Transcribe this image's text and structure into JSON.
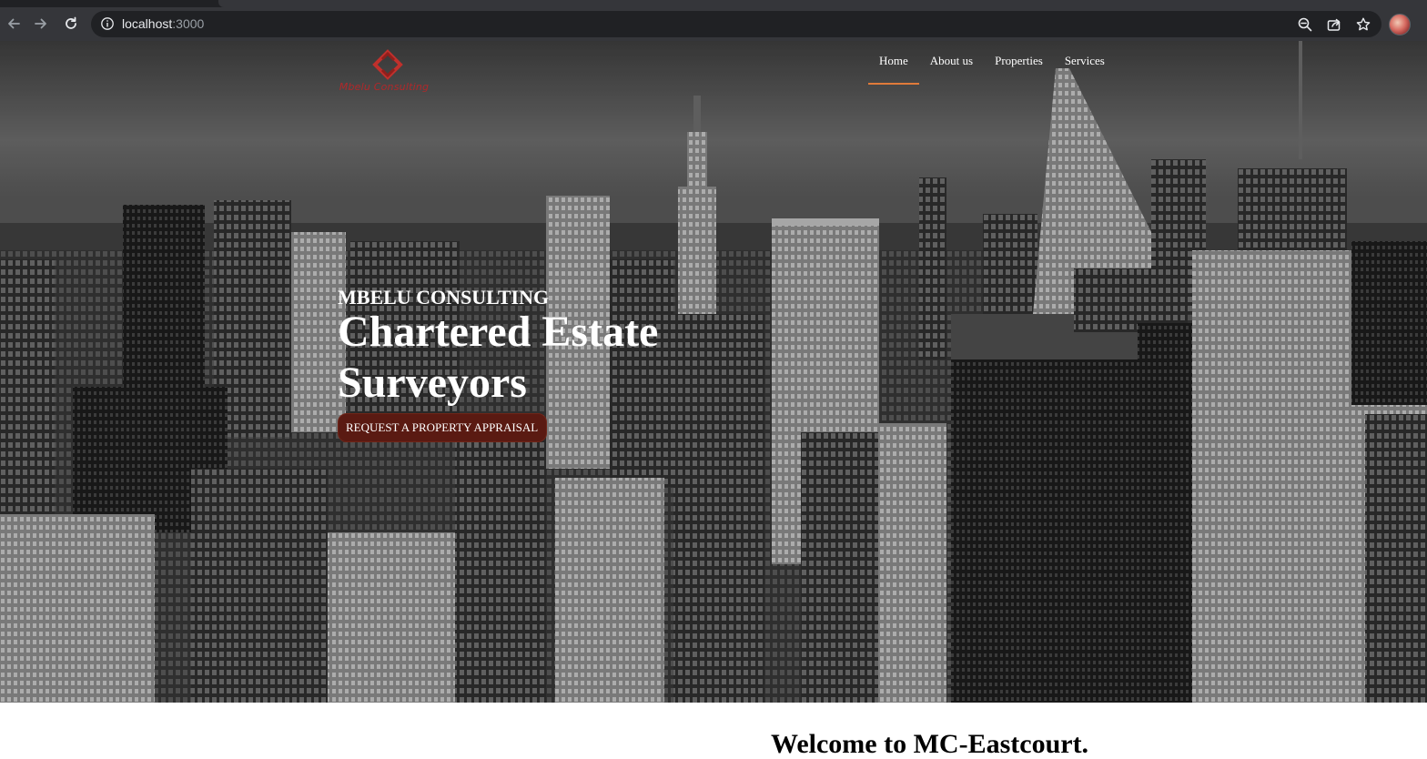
{
  "browser": {
    "url_host": "localhost",
    "url_port": ":3000",
    "icons": {
      "back": "arrow-left-icon",
      "forward": "arrow-right-icon",
      "reload": "reload-icon",
      "site_info": "info-icon",
      "zoom": "zoom-out-icon",
      "share": "share-icon",
      "bookmark": "star-icon",
      "profile": "avatar"
    }
  },
  "site": {
    "logo_text": "Mbelu Consulting",
    "brand_color": "#b0282a",
    "nav": {
      "items": [
        {
          "label": "Home",
          "active": true
        },
        {
          "label": "About us",
          "active": false
        },
        {
          "label": "Properties",
          "active": false
        },
        {
          "label": "Services",
          "active": false
        }
      ],
      "active_underline_color": "#e07a3a"
    },
    "hero": {
      "eyebrow": "MBELU CONSULTING",
      "headline": "Chartered Estate Surveyors",
      "cta_label": "REQUEST A PROPERTY APPRAISAL",
      "cta_icon": "chevron-right-icon",
      "cta_color": "#5a1a12"
    },
    "welcome_heading": "Welcome to MC-Eastcourt."
  }
}
